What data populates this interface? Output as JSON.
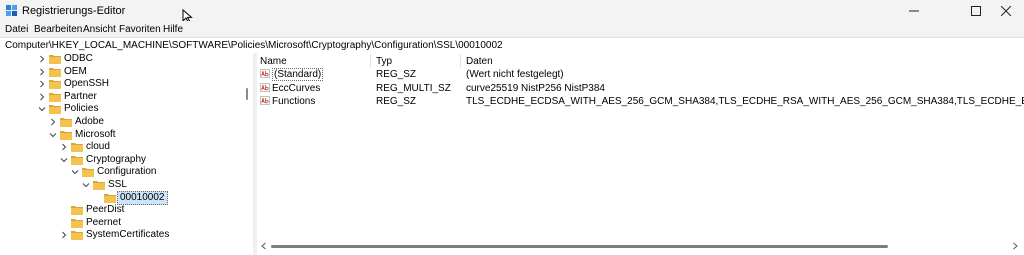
{
  "window": {
    "title": "Registrierungs-Editor"
  },
  "menu": [
    "Datei",
    "Bearbeiten",
    "Ansicht",
    "Favoriten",
    "Hilfe"
  ],
  "address": "Computer\\HKEY_LOCAL_MACHINE\\SOFTWARE\\Policies\\Microsoft\\Cryptography\\Configuration\\SSL\\00010002",
  "tree": [
    {
      "label": "ODBC",
      "level": 0,
      "state": "collapsed"
    },
    {
      "label": "OEM",
      "level": 0,
      "state": "collapsed"
    },
    {
      "label": "OpenSSH",
      "level": 0,
      "state": "collapsed"
    },
    {
      "label": "Partner",
      "level": 0,
      "state": "collapsed"
    },
    {
      "label": "Policies",
      "level": 0,
      "state": "expanded"
    },
    {
      "label": "Adobe",
      "level": 1,
      "state": "collapsed"
    },
    {
      "label": "Microsoft",
      "level": 1,
      "state": "expanded"
    },
    {
      "label": "cloud",
      "level": 2,
      "state": "collapsed"
    },
    {
      "label": "Cryptography",
      "level": 2,
      "state": "expanded"
    },
    {
      "label": "Configuration",
      "level": 3,
      "state": "expanded"
    },
    {
      "label": "SSL",
      "level": 4,
      "state": "expanded"
    },
    {
      "label": "00010002",
      "level": 5,
      "state": "leaf",
      "selected": true
    },
    {
      "label": "PeerDist",
      "level": 2,
      "state": "leaf"
    },
    {
      "label": "Peernet",
      "level": 2,
      "state": "leaf"
    },
    {
      "label": "SystemCertificates",
      "level": 2,
      "state": "collapsed"
    }
  ],
  "columns": {
    "name": "Name",
    "type": "Typ",
    "data": "Daten"
  },
  "values": [
    {
      "name": "(Standard)",
      "type": "REG_SZ",
      "data": "(Wert nicht festgelegt)"
    },
    {
      "name": "EccCurves",
      "type": "REG_MULTI_SZ",
      "data": "curve25519 NistP256 NistP384"
    },
    {
      "name": "Functions",
      "type": "REG_SZ",
      "data": "TLS_ECDHE_ECDSA_WITH_AES_256_GCM_SHA384,TLS_ECDHE_RSA_WITH_AES_256_GCM_SHA384,TLS_ECDHE_ECDSA_WITH_AES_128_GCM_SHA256,TLS_E"
    }
  ],
  "icons": {
    "app": "registry-editor-icon",
    "folder": "folder-icon",
    "value": "string-value-icon",
    "minimize": "minimize-icon",
    "maximize": "maximize-icon",
    "close": "close-icon"
  },
  "colors": {
    "folder": "#f3c24f",
    "folder_dark": "#dca632",
    "selection": "#cce4f7",
    "value_icon": "#c0392b"
  }
}
